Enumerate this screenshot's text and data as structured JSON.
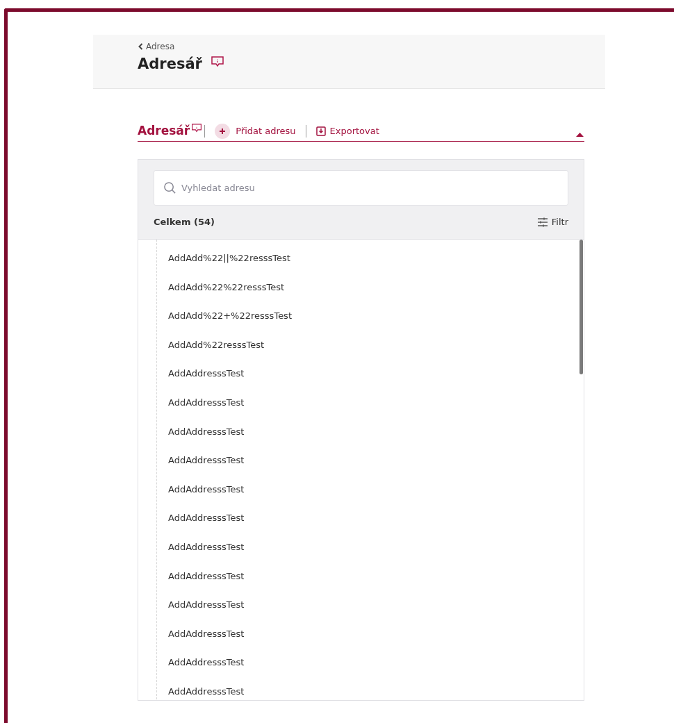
{
  "header": {
    "back_link": "Adresa",
    "title": "Adresář"
  },
  "section": {
    "title": "Adresář",
    "add_button": "Přidat adresu",
    "export_button": "Exportovat",
    "expanded": true
  },
  "search": {
    "placeholder": "Vyhledat adresu"
  },
  "summary": {
    "total": "Celkem (54)",
    "filter_button": "Filtr"
  },
  "addresses": [
    {
      "name": "AddAdd%22||%22resssTest"
    },
    {
      "name": "AddAdd%22%22resssTest"
    },
    {
      "name": "AddAdd%22+%22resssTest"
    },
    {
      "name": "AddAdd%22resssTest"
    },
    {
      "name": "AddAddresssTest"
    },
    {
      "name": "AddAddresssTest"
    },
    {
      "name": "AddAddresssTest"
    },
    {
      "name": "AddAddresssTest"
    },
    {
      "name": "AddAddresssTest"
    },
    {
      "name": "AddAddresssTest"
    },
    {
      "name": "AddAddresssTest"
    },
    {
      "name": "AddAddresssTest"
    },
    {
      "name": "AddAddresssTest"
    },
    {
      "name": "AddAddresssTest"
    },
    {
      "name": "AddAddresssTest"
    },
    {
      "name": "AddAddresssTest"
    }
  ]
}
